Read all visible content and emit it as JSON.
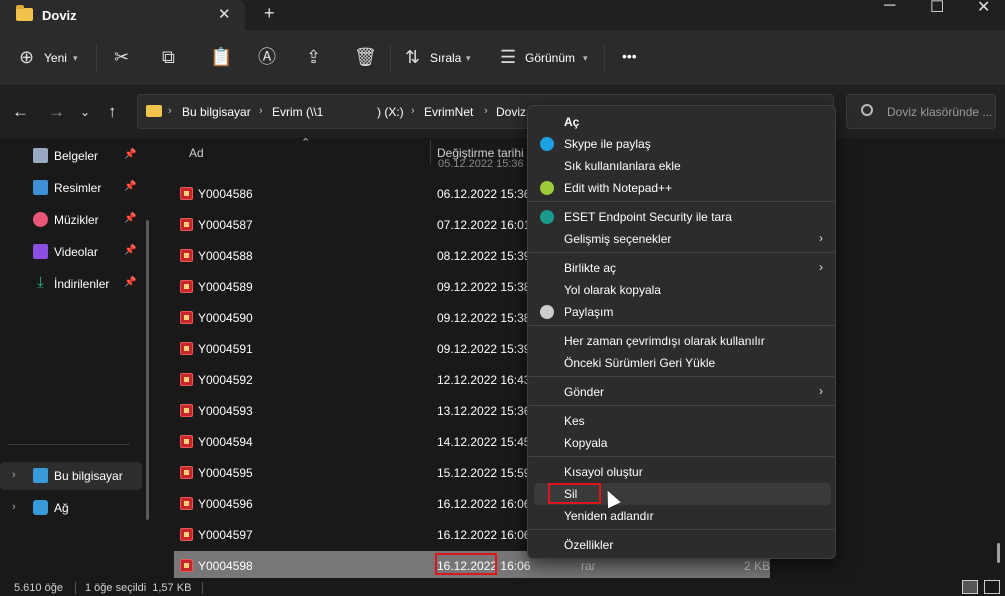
{
  "window": {
    "tab_title": "Doviz",
    "tab_close": "✕",
    "new_tab": "+",
    "minimize": "─",
    "maximize": "☐",
    "close": "✕"
  },
  "toolbar": {
    "new_label": "Yeni",
    "sort_label": "Sırala",
    "view_label": "Görünüm",
    "more": "•••"
  },
  "address": {
    "crumbs": [
      "Bu bilgisayar",
      "Evrim (\\\\1",
      ") (X:)",
      "EvrimNet",
      "Doviz"
    ],
    "search_placeholder": "Doviz klasöründe ..."
  },
  "sidebar": {
    "items": [
      {
        "label": "Belgeler",
        "icon": "documents-icon",
        "color": "#9aa9c2"
      },
      {
        "label": "Resimler",
        "icon": "pictures-icon",
        "color": "#3d8fd6"
      },
      {
        "label": "Müzikler",
        "icon": "music-icon",
        "color": "#e8567a"
      },
      {
        "label": "Videolar",
        "icon": "videos-icon",
        "color": "#8a4fe0"
      },
      {
        "label": "İndirilenler",
        "icon": "downloads-icon",
        "color": "#2fb27a"
      }
    ],
    "this_pc": "Bu bilgisayar",
    "network": "Ağ"
  },
  "columns": {
    "name": "Ad",
    "date": "Değiştirme tarihi"
  },
  "partial_row_date": "05.12.2022 15:36",
  "files": [
    {
      "name": "Y0004586",
      "date": "06.12.2022 15:36"
    },
    {
      "name": "Y0004587",
      "date": "07.12.2022 16:01"
    },
    {
      "name": "Y0004588",
      "date": "08.12.2022 15:39"
    },
    {
      "name": "Y0004589",
      "date": "09.12.2022 15:38"
    },
    {
      "name": "Y0004590",
      "date": "09.12.2022 15:38"
    },
    {
      "name": "Y0004591",
      "date": "09.12.2022 15:39"
    },
    {
      "name": "Y0004592",
      "date": "12.12.2022 16:43"
    },
    {
      "name": "Y0004593",
      "date": "13.12.2022 15:36"
    },
    {
      "name": "Y0004594",
      "date": "14.12.2022 15:45"
    },
    {
      "name": "Y0004595",
      "date": "15.12.2022 15:59"
    },
    {
      "name": "Y0004596",
      "date": "16.12.2022 16:06"
    },
    {
      "name": "Y0004597",
      "date": "16.12.2022 16:06"
    }
  ],
  "selected_file": {
    "name": "Y0004598",
    "date": "16.12.2022 16:06",
    "type": "rar",
    "size": "2 KB"
  },
  "context_menu": {
    "groups": [
      [
        {
          "label": "Aç",
          "bold": true
        },
        {
          "label": "Skype ile paylaş",
          "icon": "skype-icon",
          "icon_color": "#1ba1e2"
        },
        {
          "label": "Sık kullanılanlara ekle"
        },
        {
          "label": "Edit with Notepad++",
          "icon": "notepad-plus-plus-icon",
          "icon_color": "#9ccc3a"
        }
      ],
      [
        {
          "label": "ESET Endpoint Security ile tara",
          "icon": "eset-icon",
          "icon_color": "#1a9a8c"
        },
        {
          "label": "Gelişmiş seçenekler",
          "submenu": true
        }
      ],
      [
        {
          "label": "Birlikte aç",
          "submenu": true
        },
        {
          "label": "Yol olarak kopyala"
        },
        {
          "label": "Paylaşım",
          "icon": "share-icon",
          "icon_color": "#cccccc"
        }
      ],
      [
        {
          "label": "Her zaman çevrimdışı olarak kullanılır"
        },
        {
          "label": "Önceki Sürümleri Geri Yükle"
        }
      ],
      [
        {
          "label": "Gönder",
          "submenu": true
        }
      ],
      [
        {
          "label": "Kes"
        },
        {
          "label": "Kopyala"
        }
      ],
      [
        {
          "label": "Kısayol oluştur"
        },
        {
          "label": "Sil",
          "highlighted": true
        },
        {
          "label": "Yeniden adlandır"
        }
      ],
      [
        {
          "label": "Özellikler"
        }
      ]
    ]
  },
  "status": {
    "item_count": "5.610 öğe",
    "selection": "1 öğe seçildi  1,57 KB"
  }
}
